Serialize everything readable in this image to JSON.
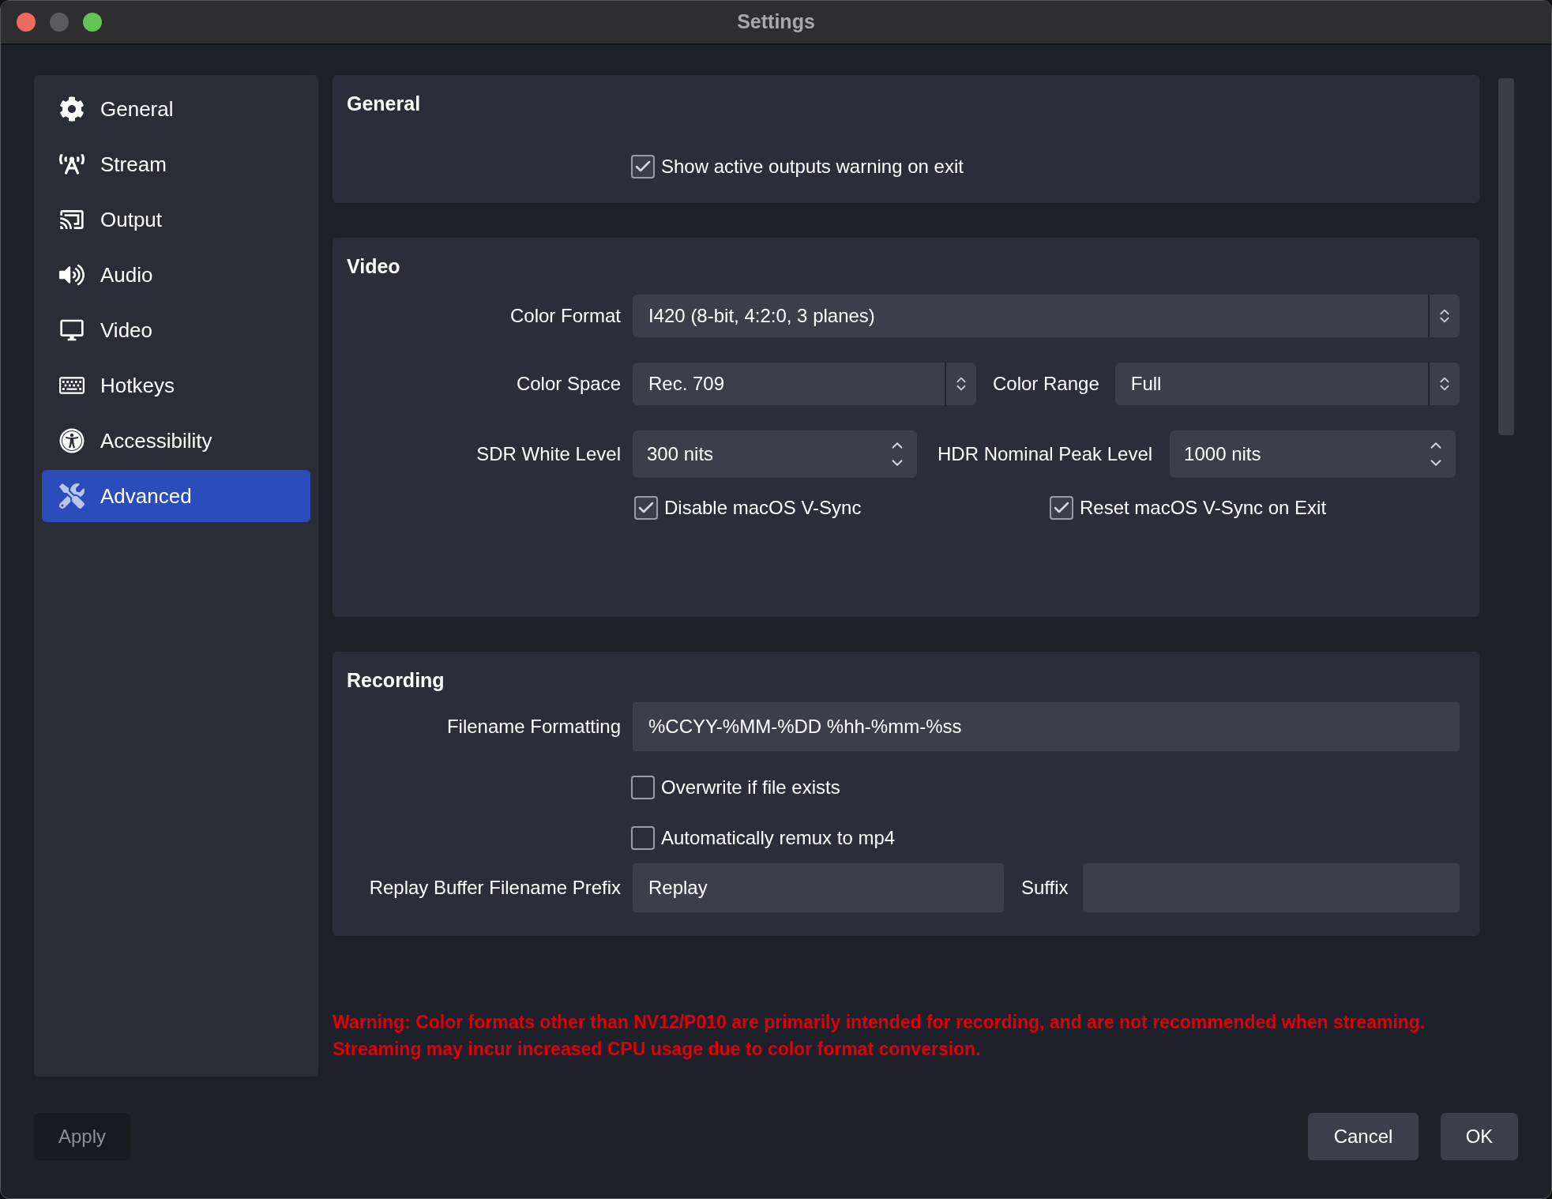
{
  "window": {
    "title": "Settings"
  },
  "sidebar": {
    "items": [
      {
        "label": "General",
        "selected": false
      },
      {
        "label": "Stream",
        "selected": false
      },
      {
        "label": "Output",
        "selected": false
      },
      {
        "label": "Audio",
        "selected": false
      },
      {
        "label": "Video",
        "selected": false
      },
      {
        "label": "Hotkeys",
        "selected": false
      },
      {
        "label": "Accessibility",
        "selected": false
      },
      {
        "label": "Advanced",
        "selected": true
      }
    ]
  },
  "general": {
    "title": "General",
    "checkboxes": [
      {
        "label": "Show active outputs warning on exit",
        "checked": true
      }
    ]
  },
  "video": {
    "title": "Video",
    "color_format": {
      "label": "Color Format",
      "value": "I420 (8-bit, 4:2:0, 3 planes)"
    },
    "color_space": {
      "label": "Color Space",
      "value": "Rec. 709"
    },
    "color_range": {
      "label": "Color Range",
      "value": "Full"
    },
    "sdr_white_level": {
      "label": "SDR White Level",
      "value": "300 nits"
    },
    "hdr_nominal_peak_level": {
      "label": "HDR Nominal Peak Level",
      "value": "1000 nits"
    },
    "checkboxes": [
      {
        "label": "Disable macOS V-Sync",
        "checked": true
      },
      {
        "label": "Reset macOS V-Sync on Exit",
        "checked": true
      }
    ]
  },
  "recording": {
    "title": "Recording",
    "filename_formatting": {
      "label": "Filename Formatting",
      "value": "%CCYY-%MM-%DD %hh-%mm-%ss"
    },
    "checkboxes": [
      {
        "label": "Overwrite if file exists",
        "checked": false
      },
      {
        "label": "Automatically remux to mp4",
        "checked": false
      }
    ],
    "replay_buffer_prefix": {
      "label": "Replay Buffer Filename Prefix",
      "value": "Replay"
    },
    "suffix": {
      "label": "Suffix"
    }
  },
  "warning": "Warning: Color formats other than NV12/P010 are primarily intended for recording, and are not recommended when streaming. Streaming may incur increased CPU usage due to color format conversion.",
  "buttons": {
    "apply": {
      "label": "Apply",
      "disabled": true
    },
    "cancel": {
      "label": "Cancel"
    },
    "ok": {
      "label": "OK"
    }
  }
}
